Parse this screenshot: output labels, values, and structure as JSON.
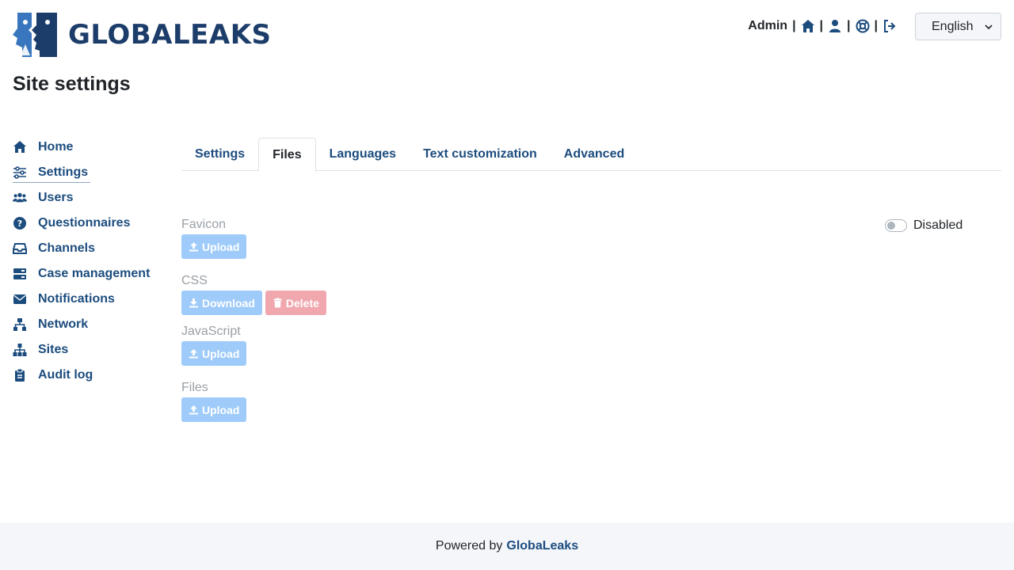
{
  "header": {
    "logo_text": "GLOBALEAKS",
    "user_name": "Admin",
    "icons": [
      "home-icon",
      "user-icon",
      "lifebuoy-icon",
      "logout-icon"
    ],
    "language": "English"
  },
  "page": {
    "title": "Site settings"
  },
  "sidebar": {
    "items": [
      {
        "label": "Home",
        "icon": "home-icon"
      },
      {
        "label": "Settings",
        "icon": "sliders-icon",
        "active": true
      },
      {
        "label": "Users",
        "icon": "users-icon"
      },
      {
        "label": "Questionnaires",
        "icon": "question-circle-icon"
      },
      {
        "label": "Channels",
        "icon": "inbox-icon"
      },
      {
        "label": "Case management",
        "icon": "server-icon"
      },
      {
        "label": "Notifications",
        "icon": "envelope-icon"
      },
      {
        "label": "Network",
        "icon": "network-icon"
      },
      {
        "label": "Sites",
        "icon": "sitemap-icon"
      },
      {
        "label": "Audit log",
        "icon": "clipboard-icon"
      }
    ]
  },
  "tabs": [
    {
      "label": "Settings"
    },
    {
      "label": "Files",
      "active": true
    },
    {
      "label": "Languages"
    },
    {
      "label": "Text customization"
    },
    {
      "label": "Advanced"
    }
  ],
  "files": {
    "favicon": {
      "label": "Favicon",
      "upload": "Upload"
    },
    "css": {
      "label": "CSS",
      "download": "Download",
      "delete": "Delete"
    },
    "javascript": {
      "label": "JavaScript",
      "upload": "Upload"
    },
    "files": {
      "label": "Files",
      "upload": "Upload"
    },
    "toggle_label": "Disabled"
  },
  "footer": {
    "prefix": "Powered by",
    "brand": "GlobaLeaks"
  },
  "colors": {
    "accent": "#1c4c7e",
    "upload_button": "#9ecbfa",
    "delete_button": "#f0a8ae"
  }
}
